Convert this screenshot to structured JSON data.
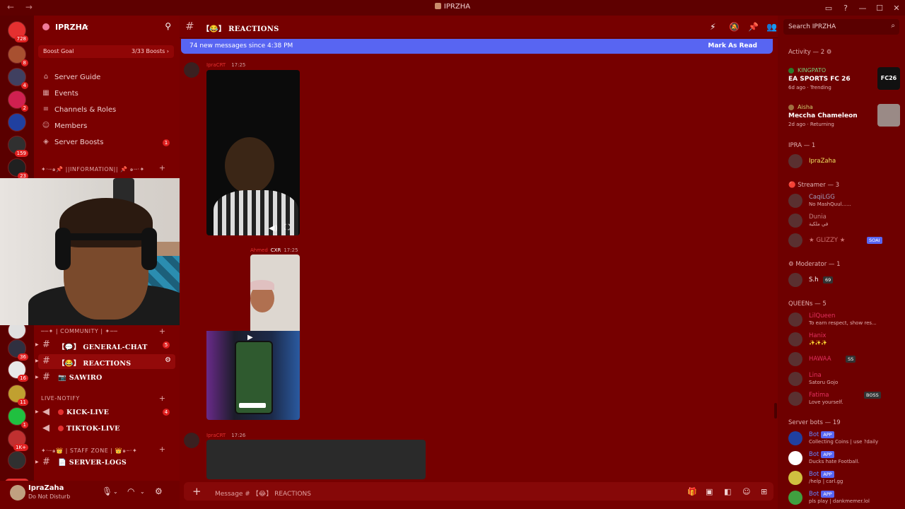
{
  "window": {
    "title": "IPRZHA",
    "nav": "← →"
  },
  "servers": {
    "badges": [
      "728",
      "8",
      "4",
      "2",
      "",
      "159",
      "23",
      "",
      "36",
      "16",
      "11",
      "1",
      "1K+"
    ],
    "new_label": "NEW"
  },
  "sidebar": {
    "server_name": "IPRZHA",
    "boost_label": "Boost Goal",
    "boost_progress": "3/33 Boosts ›",
    "menu": [
      {
        "label": "Server Guide"
      },
      {
        "label": "Events"
      },
      {
        "label": "Channels & Roles"
      },
      {
        "label": "Members"
      },
      {
        "label": "Server Boosts",
        "badge": "1"
      }
    ],
    "categories": {
      "information": "✦·┈๑📌 ||INFORMATION|| 📌 ๑┈·✦",
      "community": "──✦ | COMMUNITY | ✦──",
      "live_notify": "LIVE-NOTIFY",
      "staff": "✦·┈๑👑 | STAFF ZONE | 👑๑┈·✦"
    },
    "channels": [
      {
        "name": "GENERAL-CHAT",
        "prefix": "【💬】",
        "badge": "5"
      },
      {
        "name": "REACTIONS",
        "prefix": "【😂】"
      },
      {
        "name": "SAWIRO",
        "prefix": "📷"
      },
      {
        "name": "KICK-LIVE",
        "badge": "4"
      },
      {
        "name": "TIKTOK-LIVE"
      },
      {
        "name": "SERVER-LOGS",
        "prefix": "📄"
      }
    ]
  },
  "user": {
    "name": "IpraZaha",
    "status": "Do Not Disturb"
  },
  "chat": {
    "channel_title": "【😂】 REACTIONS",
    "new_messages": "74 new messages since 4:38 PM",
    "mark_read": "Mark As Read",
    "messages": [
      {
        "author": "IpraCRT",
        "time": "17:25"
      },
      {
        "author": "Ahmed",
        "tag": "CXR",
        "time": "17:25"
      },
      {
        "author": "IpraCRT",
        "time": "17:26"
      }
    ],
    "composer_placeholder": "Message # 【😂】 REACTIONS"
  },
  "members": {
    "search_placeholder": "Search IPRZHA",
    "activity_header": "Activity — 2",
    "activities": [
      {
        "name": "KINGPATO",
        "game": "EA SPORTS FC 26",
        "meta": "6d ago · Trending",
        "thumb": "FC26"
      },
      {
        "name": "Aisha",
        "game": "Meccha Chameleon",
        "meta": "2d ago · Returning",
        "thumb": ""
      }
    ],
    "sections": [
      {
        "title": "IPRA — 1",
        "members": [
          {
            "name": "IpraZaha",
            "sub": ""
          }
        ]
      },
      {
        "title": "🔴 Streamer — 3",
        "members": [
          {
            "name": "CaqiLGG",
            "sub": "No MashQuul......"
          },
          {
            "name": "Dunia",
            "sub": "في ملكية"
          },
          {
            "name": "★ GLIZZY ★",
            "sub": "",
            "tag": "SOAI"
          }
        ]
      },
      {
        "title": "⚙ Moderator — 1",
        "members": [
          {
            "name": "S.h",
            "sub": "",
            "tag": "69"
          }
        ]
      },
      {
        "title": "QUEENs — 5",
        "members": [
          {
            "name": "LilQueen",
            "sub": "To earn respect, show res..."
          },
          {
            "name": "Hanix",
            "sub": "✨✨✨"
          },
          {
            "name": "HAWAA",
            "sub": "",
            "tag": "SS"
          },
          {
            "name": "Lina",
            "sub": "Satoru Gojo"
          },
          {
            "name": "Fatima",
            "sub": "Love yourself.",
            "tag": "BOSS"
          }
        ]
      },
      {
        "title": "Server bots — 19",
        "members": [
          {
            "name": "Bot",
            "sub": "Collecting Coins | use ?daily",
            "tag": "APP"
          },
          {
            "name": "Bot",
            "sub": "Ducks hate Football.",
            "tag": "APP"
          },
          {
            "name": "Bot",
            "sub": "/help | carl.gg",
            "tag": "APP"
          },
          {
            "name": "Bot",
            "sub": "pls play | dankmemer.lol",
            "tag": "APP"
          }
        ]
      }
    ]
  }
}
